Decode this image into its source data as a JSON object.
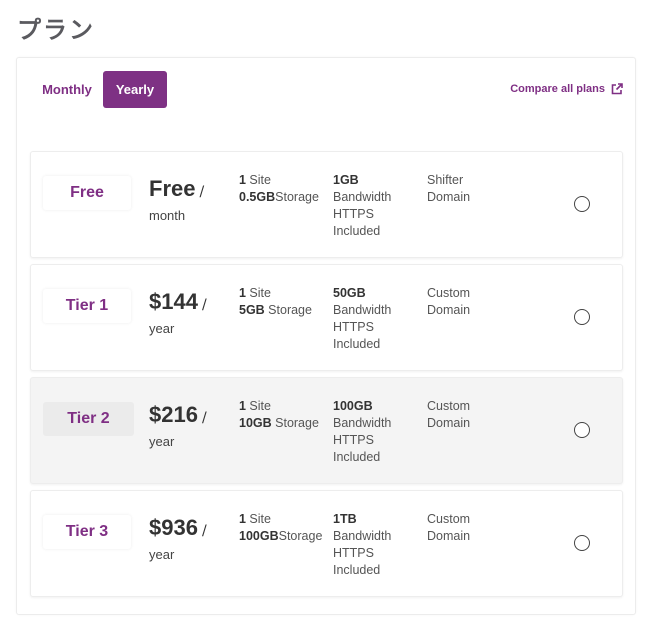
{
  "page": {
    "title": "プラン"
  },
  "billing_toggle": {
    "options": [
      "Monthly",
      "Yearly"
    ],
    "selected": "Yearly"
  },
  "compare_link": {
    "label": "Compare all plans",
    "icon": "external-link-icon"
  },
  "plans": [
    {
      "name": "Free",
      "price": "Free",
      "slash": "/",
      "period": "month",
      "sites_bold": "1",
      "sites_text": " Site",
      "storage_bold": "0.5GB",
      "storage_text": "Storage",
      "bandwidth_bold": "1GB",
      "bandwidth_text": "Bandwidth",
      "https": "HTTPS",
      "https2": "Included",
      "domain1": "Shifter",
      "domain2": "Domain",
      "selected": false
    },
    {
      "name": "Tier 1",
      "price": "$144",
      "slash": "/",
      "period": "year",
      "sites_bold": "1",
      "sites_text": " Site",
      "storage_bold": "5GB",
      "storage_text": " Storage",
      "bandwidth_bold": "50GB",
      "bandwidth_text": "Bandwidth",
      "https": "HTTPS",
      "https2": "Included",
      "domain1": "Custom",
      "domain2": "Domain",
      "selected": false
    },
    {
      "name": "Tier 2",
      "price": "$216",
      "slash": "/",
      "period": "year",
      "sites_bold": "1",
      "sites_text": " Site",
      "storage_bold": "10GB",
      "storage_text": " Storage",
      "bandwidth_bold": "100GB",
      "bandwidth_text": "Bandwidth",
      "https": "HTTPS",
      "https2": "Included",
      "domain1": "Custom",
      "domain2": "Domain",
      "selected": true
    },
    {
      "name": "Tier 3",
      "price": "$936",
      "slash": "/",
      "period": "year",
      "sites_bold": "1",
      "sites_text": " Site",
      "storage_bold": "100GB",
      "storage_text": "Storage",
      "bandwidth_bold": "1TB",
      "bandwidth_text": "Bandwidth",
      "https": "HTTPS",
      "https2": "Included",
      "domain1": "Custom",
      "domain2": "Domain",
      "selected": false
    }
  ],
  "colors": {
    "accent": "#7e3184",
    "selected_row_bg": "#f4f4f4"
  }
}
